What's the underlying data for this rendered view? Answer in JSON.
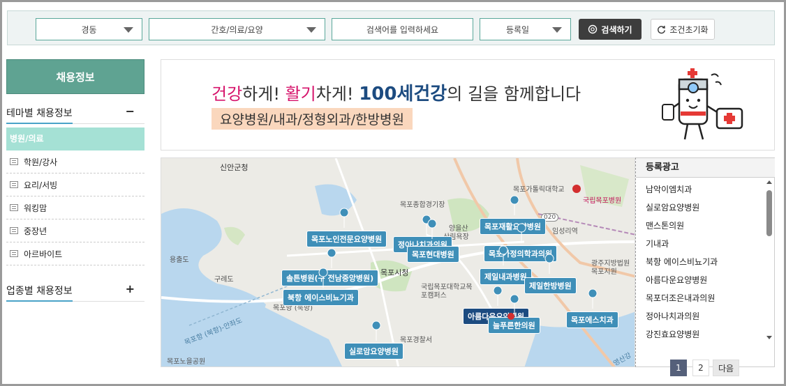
{
  "search": {
    "region": "경동",
    "category": "간호/의료/요양",
    "keyword_placeholder": "검색어를 입력하세요",
    "sort": "등록일",
    "search_button": "검색하기",
    "reset_button": "조건초기화"
  },
  "sidebar": {
    "title": "채용정보",
    "theme_section": "테마별 채용정보",
    "theme_toggle": "−",
    "active_category": "병원/의료",
    "categories": [
      "학원/강사",
      "요리/서빙",
      "워킹맘",
      "중장년",
      "아르바이트"
    ],
    "industry_section": "업종별 채용정보",
    "industry_toggle": "+"
  },
  "banner": {
    "w1": "건강",
    "w2": "하게! ",
    "w3": "활기",
    "w4": "차게! ",
    "w5": "100세건강",
    "w6": "의 길을 함께합니다",
    "line2": "요양병원/내과/정형외과/한방병원"
  },
  "map": {
    "places": [
      "신안군청",
      "목포종합경기장",
      "목포가톨릭대학교",
      "국립목포병원",
      "양을산",
      "산림욕장",
      "임성리역",
      "용출도",
      "구례도",
      "목포시청",
      "국립목포대학교목포캠퍼스",
      "광주지방법원목포지원",
      "목포항 (북항)-안좌도",
      "목포항 (북항)",
      "목포경찰서",
      "목포노을공원",
      "영산강"
    ],
    "pins": [
      "목포노인전문요양병원",
      "정아나치과의원",
      "목포현대병원",
      "목포재활요양병원",
      "목포가정의학과의원",
      "솔튼병원(구 전남중앙병원)",
      "북항 에이스비뇨기과",
      "제일내과병원",
      "제일한방병원",
      "아름다운요양병원",
      "늘푸른한의원",
      "목포에스치과",
      "실로암요양병원"
    ],
    "road_number": "020"
  },
  "ads": {
    "title": "등록광고",
    "items": [
      "남악이엠치과",
      "실로암요양병원",
      "맨스톤의원",
      "기내과",
      "북항 에이스비뇨기과",
      "아름다운요양병원",
      "목포더조은내과의원",
      "정아나치과의원",
      "강진효요양병원"
    ]
  },
  "pager": {
    "p1": "1",
    "p2": "2",
    "next": "다음"
  },
  "colors": {
    "accent": "#5fa392",
    "pin": "#3f8fb8",
    "active_category": "#a5e1d5"
  }
}
